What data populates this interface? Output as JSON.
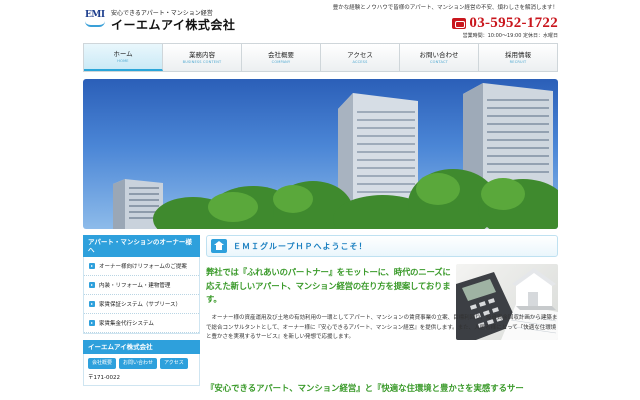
{
  "header": {
    "logo_mark": "EMI",
    "logo_tagline": "安心できるアパート・マンション経営",
    "company_name": "イーエムアイ株式会社",
    "tagline": "豊かな経験とノウハウで皆様のアパート、マンション経営の不安、煩わしさを解消します！",
    "phone": "03-5952-1722",
    "hours": "営業時間：10:00〜19:00 定休日：水曜日",
    "phone_icon": "phone-icon"
  },
  "nav": [
    {
      "jp": "ホーム",
      "en": "HOME"
    },
    {
      "jp": "業務内容",
      "en": "BUSINESS CONTENT"
    },
    {
      "jp": "会社概要",
      "en": "COMPANY"
    },
    {
      "jp": "アクセス",
      "en": "ACCESS"
    },
    {
      "jp": "お問い合わせ",
      "en": "CONTACT"
    },
    {
      "jp": "採用情報",
      "en": "RECRUIT"
    }
  ],
  "sidebar": {
    "heading": "アパート・マンションのオーナー様へ",
    "items": [
      {
        "label": "オーナー様向けリフォームのご提案"
      },
      {
        "label": "内装・リフォーム・建物管理"
      },
      {
        "label": "家賃保証システム（サブリース）"
      },
      {
        "label": "家賃集金代行システム"
      }
    ],
    "company_heading": "イーエムアイ株式会社",
    "company_buttons": [
      "会社概要",
      "お問い合わせ",
      "アクセス"
    ],
    "zip": "〒171-0022"
  },
  "main": {
    "welcome": "ＥＭＩグループＨＰへようこそ！",
    "lead": "弊社では『ふれあいのパートナー』をモットーに、時代のニーズに応えた新しいアパート、マンション経営の在り方を提案しております。",
    "body": "オーナー様の資産運用及び土地の有効利用の一環としてアパート、マンションの賃貸事業の立案、目標利回り、投資資金回収計画から建築まで総合コンサルタントとして、オーナー様に『安心できるアパート、マンション経営』を提供します。また、入居者様にとって『快適な住環境と豊かさを実現するサービス』を新しい発想で応援します。",
    "tagline": "『安心できるアパート、マンション経営』と『快適な住環境と豊かさを実感するサー"
  },
  "colors": {
    "accent": "#2ea0dc",
    "phone": "#c9161d",
    "lead_green": "#3a9a2a",
    "brand_navy": "#1b3c8c"
  }
}
